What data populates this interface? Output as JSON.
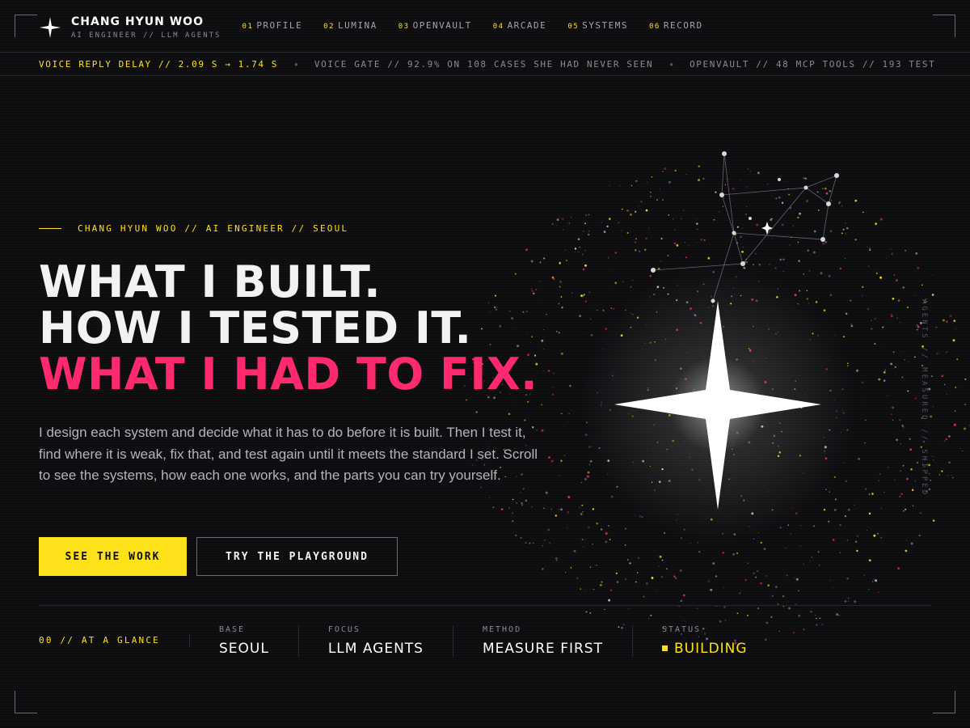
{
  "brand": {
    "name": "CHANG HYUN WOO",
    "subtitle": "AI ENGINEER // LLM AGENTS"
  },
  "nav": [
    {
      "num": "01",
      "label": "PROFILE"
    },
    {
      "num": "02",
      "label": "LUMINA"
    },
    {
      "num": "03",
      "label": "OPENVAULT"
    },
    {
      "num": "04",
      "label": "ARCADE"
    },
    {
      "num": "05",
      "label": "SYSTEMS"
    },
    {
      "num": "06",
      "label": "RECORD"
    }
  ],
  "ticker": [
    "VOICE REPLY DELAY // 2.09 S → 1.74 S",
    "VOICE GATE // 92.9% ON 108 CASES SHE HAD NEVER SEEN",
    "OPENVAULT // 48 MCP TOOLS // 193 TEST"
  ],
  "hero": {
    "eyebrow": "CHANG HYUN WOO // AI ENGINEER // SEOUL",
    "line1": "WHAT I BUILT.",
    "line2": "HOW I TESTED IT.",
    "line3": "WHAT I HAD TO FIX.",
    "lede": "I design each system and decide what it has to do before it is built. Then I test it, find where it is weak, fix that, and test again until it meets the standard I set. Scroll to see the systems, how each one works, and the parts you can try yourself.",
    "primary_cta": "SEE THE WORK",
    "secondary_cta": "TRY THE PLAYGROUND"
  },
  "glance": {
    "label": "00 // AT A GLANCE",
    "stats": [
      {
        "key": "BASE",
        "value": "SEOUL"
      },
      {
        "key": "FOCUS",
        "value": "LLM AGENTS"
      },
      {
        "key": "METHOD",
        "value": "MEASURE FIRST"
      },
      {
        "key": "STATUS",
        "value": "BUILDING"
      }
    ]
  },
  "side_caption": "AGENTS // MEASURED // SHIPPED",
  "colors": {
    "accent": "#ffe11a",
    "highlight": "#ff2a6d",
    "background": "#0d0d10"
  },
  "icons": {
    "logo": "four-point-star-icon",
    "hero_art": "glowing-star-icon"
  }
}
